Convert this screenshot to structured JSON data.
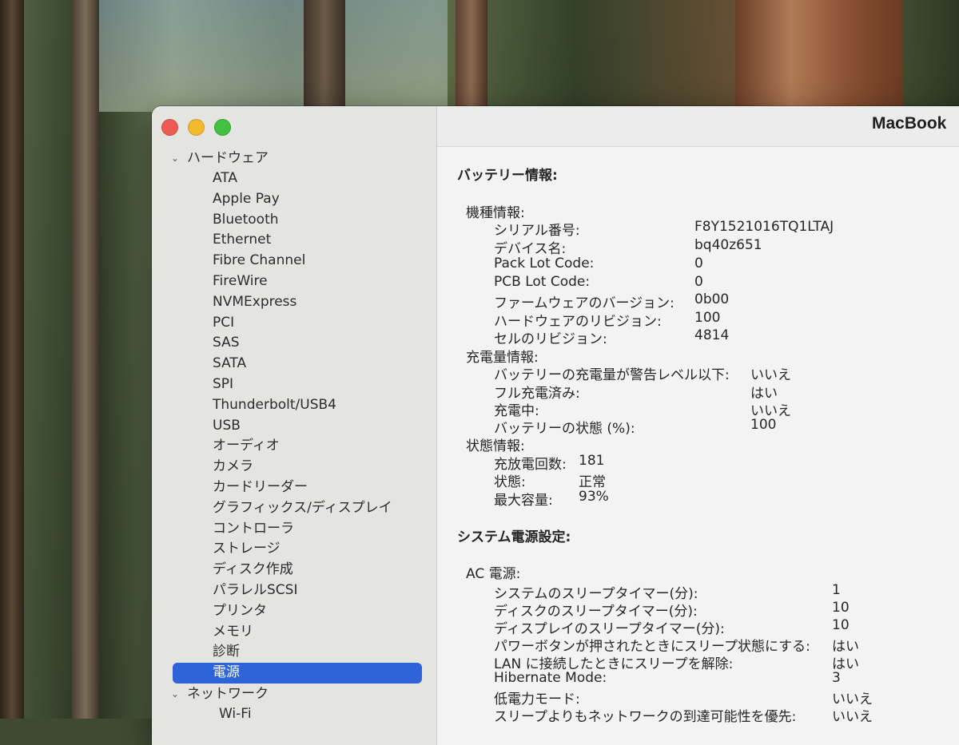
{
  "window": {
    "title": "MacBook"
  },
  "sidebar": {
    "hardware_label": "ハードウェア",
    "items": [
      "ATA",
      "Apple Pay",
      "Bluetooth",
      "Ethernet",
      "Fibre Channel",
      "FireWire",
      "NVMExpress",
      "PCI",
      "SAS",
      "SATA",
      "SPI",
      "Thunderbolt/USB4",
      "USB",
      "オーディオ",
      "カメラ",
      "カードリーダー",
      "グラフィックス/ディスプレイ",
      "コントローラ",
      "ストレージ",
      "ディスク作成",
      "パラレルSCSI",
      "プリンタ",
      "メモリ",
      "診断",
      "電源"
    ],
    "selected_item": "電源",
    "network_label": "ネットワーク",
    "network_items": [
      "Wi-Fi"
    ]
  },
  "battery": {
    "heading": "バッテリー情報:",
    "model": {
      "label": "機種情報:",
      "rows": [
        {
          "k": "シリアル番号:",
          "v": "F8Y1521016TQ1LTAJ"
        },
        {
          "k": "デバイス名:",
          "v": "bq40z651"
        },
        {
          "k": "Pack Lot Code:",
          "v": "0"
        },
        {
          "k": "PCB Lot Code:",
          "v": "0"
        },
        {
          "k": "ファームウェアのバージョン:",
          "v": "0b00"
        },
        {
          "k": "ハードウェアのリビジョン:",
          "v": "100"
        },
        {
          "k": "セルのリビジョン:",
          "v": "4814"
        }
      ]
    },
    "charge": {
      "label": "充電量情報:",
      "rows": [
        {
          "k": "バッテリーの充電量が警告レベル以下:",
          "v": "いいえ"
        },
        {
          "k": "フル充電済み:",
          "v": "はい"
        },
        {
          "k": "充電中:",
          "v": "いいえ"
        },
        {
          "k": "バッテリーの状態 (%):",
          "v": "100"
        }
      ]
    },
    "health": {
      "label": "状態情報:",
      "rows": [
        {
          "k": "充放電回数:",
          "v": "181"
        },
        {
          "k": "状態:",
          "v": "正常"
        },
        {
          "k": "最大容量:",
          "v": "93%"
        }
      ]
    }
  },
  "power": {
    "heading": "システム電源設定:",
    "ac": {
      "label": "AC 電源:",
      "rows": [
        {
          "k": "システムのスリープタイマー(分):",
          "v": "1"
        },
        {
          "k": "ディスクのスリープタイマー(分):",
          "v": "10"
        },
        {
          "k": "ディスプレイのスリープタイマー(分):",
          "v": "10"
        },
        {
          "k": "パワーボタンが押されたときにスリープ状態にする:",
          "v": "はい"
        },
        {
          "k": "LAN に接続したときにスリープを解除:",
          "v": "はい"
        },
        {
          "k": "Hibernate Mode:",
          "v": "3"
        },
        {
          "k": "低電力モード:",
          "v": "いいえ"
        },
        {
          "k": "スリープよりもネットワークの到達可能性を優先:",
          "v": "いいえ"
        }
      ]
    }
  }
}
